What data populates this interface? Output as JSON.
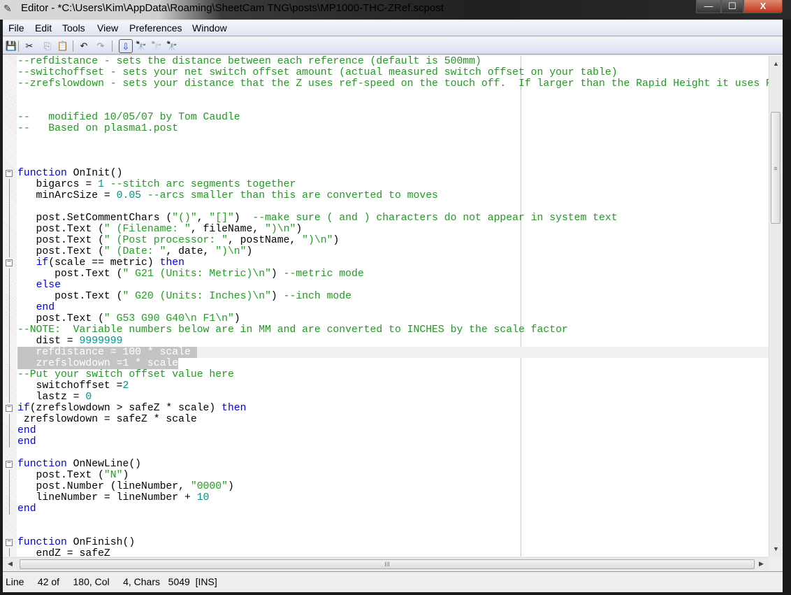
{
  "window": {
    "title": "Editor - *C:\\Users\\Kim\\AppData\\Roaming\\SheetCam TNG\\posts\\MP1000-THC-ZRef.scpost",
    "minimize": "—",
    "maximize": "☐",
    "close": "X"
  },
  "menu": [
    "File",
    "Edit",
    "Tools",
    "View",
    "Preferences",
    "Window"
  ],
  "toolbar": [
    {
      "icon": "save-icon",
      "glyph": "💾"
    },
    {
      "icon": "cut-icon",
      "glyph": "✂"
    },
    {
      "icon": "copy-icon",
      "glyph": "⎘"
    },
    {
      "icon": "paste-icon",
      "glyph": "📋"
    },
    {
      "icon": "undo-icon",
      "glyph": "↶"
    },
    {
      "icon": "redo-icon",
      "glyph": "↷"
    },
    {
      "icon": "find-down-icon",
      "glyph": "⇩"
    },
    {
      "icon": "find-icon",
      "glyph": "🔭"
    },
    {
      "icon": "find-next-icon",
      "glyph": "🔭"
    },
    {
      "icon": "replace-icon",
      "glyph": "🔭"
    }
  ],
  "colors": {
    "comment": "#229922",
    "keyword": "#0000e0",
    "string": "#22a022",
    "number": "#009688"
  },
  "code": [
    [
      [
        "c",
        "--refdistance - sets the distance between each reference (default is 500mm)"
      ]
    ],
    [
      [
        "c",
        "--switchoffset - sets your net switch offset amount (actual measured switch offset on your table)"
      ]
    ],
    [
      [
        "c",
        "--zrefslowdown - sets your distance that the Z uses ref-speed on the touch off.  If larger than the Rapid Height it uses Rapid Height"
      ]
    ],
    [],
    [],
    [
      [
        "c",
        "--   modified 10/05/07 by Tom Caudle"
      ]
    ],
    [
      [
        "c",
        "--   Based on plasma1.post"
      ]
    ],
    [],
    [],
    [],
    [
      [
        "k",
        "function"
      ],
      [
        "p",
        " OnInit()"
      ]
    ],
    [
      [
        "p",
        "   bigarcs = "
      ],
      [
        "n",
        "1"
      ],
      [
        "c",
        " --stitch arc segments together"
      ]
    ],
    [
      [
        "p",
        "   minArcSize = "
      ],
      [
        "n",
        "0.05"
      ],
      [
        "c",
        " --arcs smaller than this are converted to moves"
      ]
    ],
    [],
    [
      [
        "p",
        "   post.SetCommentChars ("
      ],
      [
        "s",
        "\"()\""
      ],
      [
        "p",
        ", "
      ],
      [
        "s",
        "\"[]\""
      ],
      [
        "p",
        ")  "
      ],
      [
        "c",
        "--make sure ( and ) characters do not appear in system text"
      ]
    ],
    [
      [
        "p",
        "   post.Text ("
      ],
      [
        "s",
        "\" (Filename: \""
      ],
      [
        "p",
        ", fileName, "
      ],
      [
        "s",
        "\")\\n\""
      ],
      [
        "p",
        ")"
      ]
    ],
    [
      [
        "p",
        "   post.Text ("
      ],
      [
        "s",
        "\" (Post processor: \""
      ],
      [
        "p",
        ", postName, "
      ],
      [
        "s",
        "\")\\n\""
      ],
      [
        "p",
        ")"
      ]
    ],
    [
      [
        "p",
        "   post.Text ("
      ],
      [
        "s",
        "\" (Date: \""
      ],
      [
        "p",
        ", date, "
      ],
      [
        "s",
        "\")\\n\""
      ],
      [
        "p",
        ")"
      ]
    ],
    [
      [
        "p",
        "   "
      ],
      [
        "k",
        "if"
      ],
      [
        "p",
        "(scale == metric) "
      ],
      [
        "k",
        "then"
      ]
    ],
    [
      [
        "p",
        "      post.Text ("
      ],
      [
        "s",
        "\" G21 (Units: Metric)\\n\""
      ],
      [
        "p",
        ") "
      ],
      [
        "c",
        "--metric mode"
      ]
    ],
    [
      [
        "p",
        "   "
      ],
      [
        "k",
        "else"
      ]
    ],
    [
      [
        "p",
        "      post.Text ("
      ],
      [
        "s",
        "\" G20 (Units: Inches)\\n\""
      ],
      [
        "p",
        ") "
      ],
      [
        "c",
        "--inch mode"
      ]
    ],
    [
      [
        "p",
        "   "
      ],
      [
        "k",
        "end"
      ]
    ],
    [
      [
        "p",
        "   post.Text ("
      ],
      [
        "s",
        "\" G53 G90 G40\\n F1\\n\""
      ],
      [
        "p",
        ")"
      ]
    ],
    [
      [
        "c",
        "--NOTE:  Variable numbers below are in MM and are converted to INCHES by the scale factor"
      ]
    ],
    [
      [
        "p",
        "   dist = "
      ],
      [
        "n",
        "9999999"
      ]
    ],
    [
      [
        "sel",
        "   refdistance = 100 * scale "
      ]
    ],
    [
      [
        "sel",
        "   zrefslowdown =1 * scale"
      ]
    ],
    [
      [
        "c",
        "--Put your switch offset value here"
      ]
    ],
    [
      [
        "p",
        "   switchoffset ="
      ],
      [
        "n",
        "2"
      ]
    ],
    [
      [
        "p",
        "   lastz = "
      ],
      [
        "n",
        "0"
      ]
    ],
    [
      [
        "k",
        "if"
      ],
      [
        "p",
        "(zrefslowdown > safeZ * scale) "
      ],
      [
        "k",
        "then"
      ]
    ],
    [
      [
        "p",
        " zrefslowdown = safeZ * scale"
      ]
    ],
    [
      [
        "k",
        "end"
      ]
    ],
    [
      [
        "k",
        "end"
      ]
    ],
    [],
    [
      [
        "k",
        "function"
      ],
      [
        "p",
        " OnNewLine()"
      ]
    ],
    [
      [
        "p",
        "   post.Text ("
      ],
      [
        "s",
        "\"N\""
      ],
      [
        "p",
        ")"
      ]
    ],
    [
      [
        "p",
        "   post.Number (lineNumber, "
      ],
      [
        "s",
        "\"0000\""
      ],
      [
        "p",
        ")"
      ]
    ],
    [
      [
        "p",
        "   lineNumber = lineNumber + "
      ],
      [
        "n",
        "10"
      ]
    ],
    [
      [
        "k",
        "end"
      ]
    ],
    [],
    [],
    [
      [
        "k",
        "function"
      ],
      [
        "p",
        " OnFinish()"
      ]
    ],
    [
      [
        "p",
        "   endZ = safeZ"
      ]
    ]
  ],
  "status": {
    "text": "Line     42 of     180, Col     4, Chars   5049  [INS]"
  }
}
